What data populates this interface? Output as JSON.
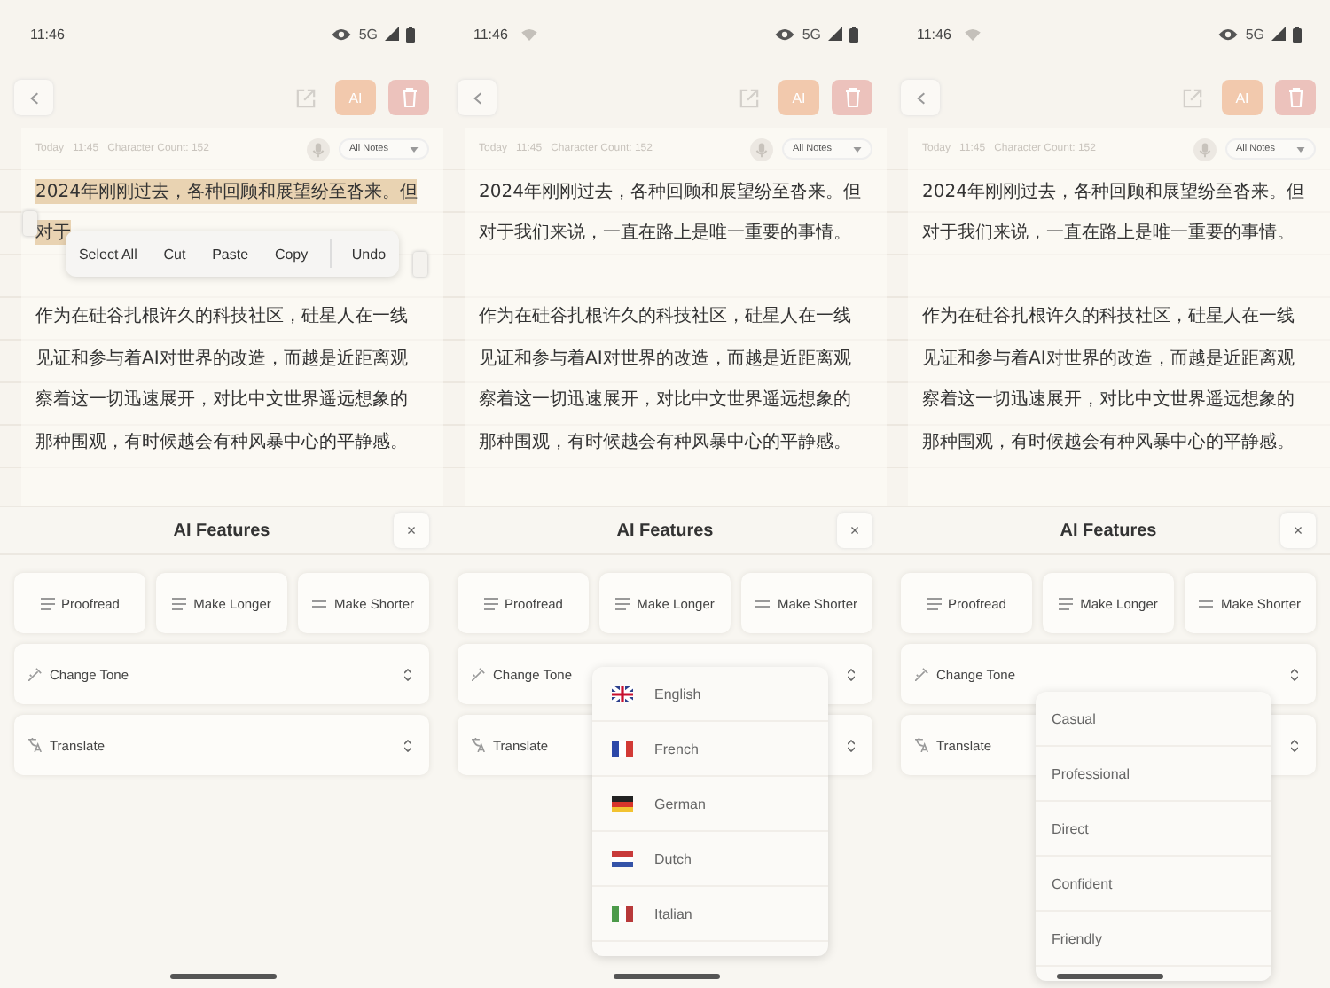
{
  "screens": [
    {
      "status_bar": {
        "time": "11:46",
        "wifi_icon": false,
        "network": "5G"
      },
      "toolbar": {
        "ai_label": "AI"
      },
      "note": {
        "date": "Today",
        "time": "11:45",
        "character_count": "Character Count: 152",
        "folder": "All Notes",
        "paragraphs": [
          {
            "lines": [
              {
                "text": "2024年刚刚过去，各种回顾和展望纷至沓来。但",
                "selected": true
              },
              {
                "text": "对于",
                "selected": true
              }
            ]
          },
          {
            "lines": [
              {
                "text": "作为在硅谷扎根许久的科技社区，硅星人在一线",
                "selected": false
              },
              {
                "text": "见证和参与着AI对世界的改造，而越是近距离观",
                "selected": false
              },
              {
                "text": "察着这一切迅速展开，对比中文世界遥远想象的",
                "selected": false
              },
              {
                "text": "那种围观，有时候越会有种风暴中心的平静感。",
                "selected": false
              }
            ]
          }
        ]
      },
      "context_menu": {
        "items": [
          "Select All",
          "Cut",
          "Paste",
          "Copy",
          "Undo"
        ]
      },
      "ai_panel": {
        "title": "AI Features",
        "close": "×",
        "actions": [
          "Proofread",
          "Make Longer",
          "Make Shorter"
        ],
        "selects": [
          {
            "label": "Change Tone",
            "kind": "tone"
          },
          {
            "label": "Translate",
            "kind": "translate"
          }
        ]
      }
    },
    {
      "status_bar": {
        "time": "11:46",
        "wifi_icon": true,
        "network": "5G"
      },
      "toolbar": {
        "ai_label": "AI"
      },
      "note": {
        "date": "Today",
        "time": "11:45",
        "character_count": "Character Count: 152",
        "folder": "All Notes",
        "paragraphs": [
          {
            "lines": [
              {
                "text": "2024年刚刚过去，各种回顾和展望纷至沓来。但",
                "selected": false
              },
              {
                "text": "对于我们来说，一直在路上是唯一重要的事情。",
                "selected": false
              }
            ]
          },
          {
            "lines": [
              {
                "text": "作为在硅谷扎根许久的科技社区，硅星人在一线",
                "selected": false
              },
              {
                "text": "见证和参与着AI对世界的改造，而越是近距离观",
                "selected": false
              },
              {
                "text": "察着这一切迅速展开，对比中文世界遥远想象的",
                "selected": false
              },
              {
                "text": "那种围观，有时候越会有种风暴中心的平静感。",
                "selected": false
              }
            ]
          }
        ]
      },
      "ai_panel": {
        "title": "AI Features",
        "close": "×",
        "actions": [
          "Proofread",
          "Make Longer",
          "Make Shorter"
        ],
        "selects": [
          {
            "label": "Change Tone",
            "kind": "tone"
          },
          {
            "label": "Translate",
            "kind": "translate"
          }
        ]
      },
      "dropdown": {
        "kind": "languages",
        "items": [
          {
            "label": "English",
            "kind": "uk"
          },
          {
            "label": "French",
            "kind": "fr"
          },
          {
            "label": "German",
            "kind": "de"
          },
          {
            "label": "Dutch",
            "kind": "nl"
          },
          {
            "label": "Italian",
            "kind": "it"
          }
        ]
      }
    },
    {
      "status_bar": {
        "time": "11:46",
        "wifi_icon": true,
        "network": "5G"
      },
      "toolbar": {
        "ai_label": "AI"
      },
      "note": {
        "date": "Today",
        "time": "11:45",
        "character_count": "Character Count: 152",
        "folder": "All Notes",
        "paragraphs": [
          {
            "lines": [
              {
                "text": "2024年刚刚过去，各种回顾和展望纷至沓来。但",
                "selected": false
              },
              {
                "text": "对于我们来说，一直在路上是唯一重要的事情。",
                "selected": false
              }
            ]
          },
          {
            "lines": [
              {
                "text": "作为在硅谷扎根许久的科技社区，硅星人在一线",
                "selected": false
              },
              {
                "text": "见证和参与着AI对世界的改造，而越是近距离观",
                "selected": false
              },
              {
                "text": "察着这一切迅速展开，对比中文世界遥远想象的",
                "selected": false
              },
              {
                "text": "那种围观，有时候越会有种风暴中心的平静感。",
                "selected": false
              }
            ]
          }
        ]
      },
      "ai_panel": {
        "title": "AI Features",
        "close": "×",
        "actions": [
          "Proofread",
          "Make Longer",
          "Make Shorter"
        ],
        "selects": [
          {
            "label": "Change Tone",
            "kind": "tone"
          },
          {
            "label": "Translate",
            "kind": "translate"
          }
        ]
      },
      "dropdown": {
        "kind": "tones",
        "items": [
          {
            "label": "Casual"
          },
          {
            "label": "Professional"
          },
          {
            "label": "Direct"
          },
          {
            "label": "Confident"
          },
          {
            "label": "Friendly"
          }
        ]
      }
    }
  ]
}
